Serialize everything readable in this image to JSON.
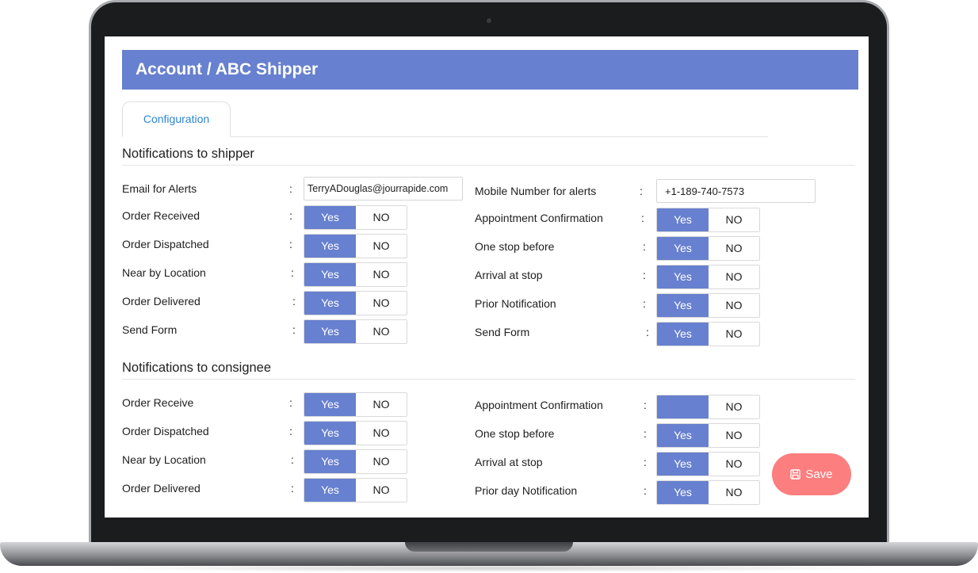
{
  "header": {
    "title": "Account / ABC Shipper"
  },
  "tabs": [
    {
      "label": "Configuration"
    }
  ],
  "toggle_labels": {
    "yes": "Yes",
    "no": "NO"
  },
  "shipper": {
    "section_title": "Notifications to shipper",
    "left": {
      "email": {
        "label": "Email for Alerts",
        "value": "TerryADouglas@jourrapide.com"
      },
      "rows": [
        {
          "label": "Order Received",
          "selected": "Yes"
        },
        {
          "label": "Order Dispatched",
          "selected": "Yes"
        },
        {
          "label": "Near by Location",
          "selected": "Yes"
        },
        {
          "label": "Order Delivered",
          "selected": "Yes"
        },
        {
          "label": "Send Form",
          "selected": "Yes"
        }
      ]
    },
    "right": {
      "mobile": {
        "label": "Mobile Number for alerts",
        "value": "+1-189-740-7573"
      },
      "rows": [
        {
          "label": "Appointment Confirmation",
          "selected": "Yes"
        },
        {
          "label": "One stop before",
          "selected": "Yes"
        },
        {
          "label": "Arrival at stop",
          "selected": "Yes"
        },
        {
          "label": "Prior Notification",
          "selected": "Yes"
        },
        {
          "label": "Send Form",
          "selected": "Yes"
        }
      ]
    }
  },
  "consignee": {
    "section_title": "Notifications to consignee",
    "left": {
      "rows": [
        {
          "label": "Order Receive",
          "selected": "Yes"
        },
        {
          "label": "Order Dispatched",
          "selected": "Yes"
        },
        {
          "label": "Near by Location",
          "selected": "Yes"
        },
        {
          "label": "Order Delivered",
          "selected": "Yes"
        }
      ]
    },
    "right": {
      "rows": [
        {
          "label": "Appointment Confirmation",
          "selected": "Yes",
          "yes_text_visible": false
        },
        {
          "label": "One stop before",
          "selected": "Yes"
        },
        {
          "label": "Arrival at stop",
          "selected": "Yes"
        },
        {
          "label": "Prior day Notification",
          "selected": "Yes"
        }
      ]
    }
  },
  "save": {
    "label": "Save",
    "icon": "floppy-disk-icon"
  },
  "colors": {
    "accent": "#6780cf",
    "save_button": "#fc7e7e",
    "tab_text": "#2d86d6"
  }
}
